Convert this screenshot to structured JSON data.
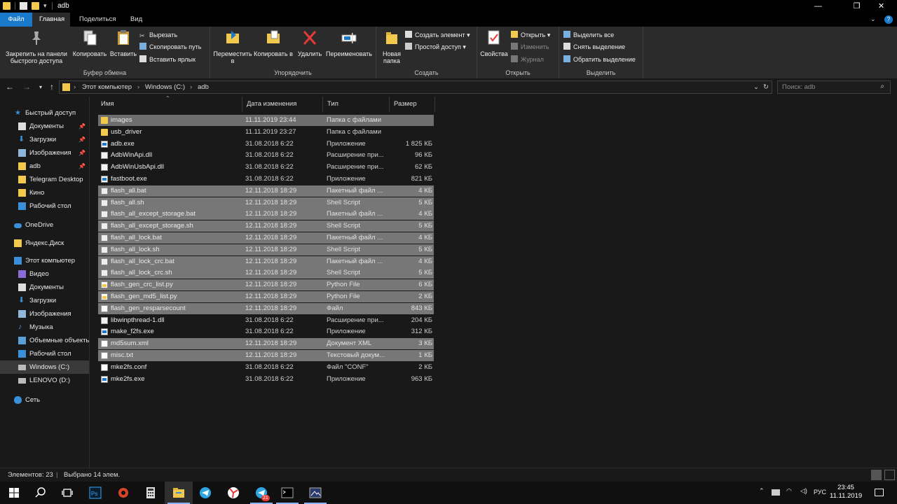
{
  "window": {
    "title": "adb",
    "controls": {
      "minimize": "—",
      "maximize": "❐",
      "close": "✕"
    }
  },
  "ribbon_tabs": [
    "Файл",
    "Главная",
    "Поделиться",
    "Вид"
  ],
  "ribbon": {
    "clipboard": {
      "pin_label": "Закрепить на панели быстрого доступа",
      "copy": "Копировать",
      "paste": "Вставить",
      "cut": "Вырезать",
      "copy_path": "Скопировать путь",
      "paste_shortcut": "Вставить ярлык",
      "group": "Буфер обмена"
    },
    "organize": {
      "move": "Переместить в",
      "copy_to": "Копировать в",
      "delete": "Удалить",
      "rename": "Переименовать",
      "group": "Упорядочить"
    },
    "new": {
      "new_folder": "Новая папка",
      "new_item": "Создать элемент",
      "easy_access": "Простой доступ",
      "group": "Создать"
    },
    "open": {
      "properties": "Свойства",
      "open": "Открыть",
      "edit": "Изменить",
      "history": "Журнал",
      "group": "Открыть"
    },
    "select": {
      "select_all": "Выделить все",
      "select_none": "Снять выделение",
      "invert": "Обратить выделение",
      "group": "Выделить"
    }
  },
  "address": {
    "crumbs": [
      "Этот компьютер",
      "Windows (C:)",
      "adb"
    ],
    "search_placeholder": "Поиск: adb"
  },
  "nav": {
    "quick_access": "Быстрый доступ",
    "items": [
      "Документы",
      "Загрузки",
      "Изображения",
      "adb",
      "Telegram Desktop",
      "Кино",
      "Рабочий стол"
    ],
    "onedrive": "OneDrive",
    "yandex": "Яндекс.Диск",
    "this_pc": "Этот компьютер",
    "pc_items": [
      "Видео",
      "Документы",
      "Загрузки",
      "Изображения",
      "Музыка",
      "Объемные объекты",
      "Рабочий стол",
      "Windows (C:)",
      "LENOVO (D:)"
    ],
    "network": "Сеть"
  },
  "columns": {
    "name": "Имя",
    "date": "Дата изменения",
    "type": "Тип",
    "size": "Размер"
  },
  "files": [
    {
      "name": "images",
      "date": "11.11.2019 23:44",
      "type": "Папка с файлами",
      "size": "",
      "icon": "folder",
      "selected": true
    },
    {
      "name": "usb_driver",
      "date": "11.11.2019 23:27",
      "type": "Папка с файлами",
      "size": "",
      "icon": "folder",
      "selected": false
    },
    {
      "name": "adb.exe",
      "date": "31.08.2018 6:22",
      "type": "Приложение",
      "size": "1 825 КБ",
      "icon": "exe",
      "selected": false
    },
    {
      "name": "AdbWinApi.dll",
      "date": "31.08.2018 6:22",
      "type": "Расширение при...",
      "size": "96 КБ",
      "icon": "dll",
      "selected": false
    },
    {
      "name": "AdbWinUsbApi.dll",
      "date": "31.08.2018 6:22",
      "type": "Расширение при...",
      "size": "62 КБ",
      "icon": "dll",
      "selected": false
    },
    {
      "name": "fastboot.exe",
      "date": "31.08.2018 6:22",
      "type": "Приложение",
      "size": "821 КБ",
      "icon": "exe",
      "selected": false
    },
    {
      "name": "flash_all.bat",
      "date": "12.11.2018 18:29",
      "type": "Пакетный файл ...",
      "size": "4 КБ",
      "icon": "script",
      "selected": true
    },
    {
      "name": "flash_all.sh",
      "date": "12.11.2018 18:29",
      "type": "Shell Script",
      "size": "5 КБ",
      "icon": "script",
      "selected": true
    },
    {
      "name": "flash_all_except_storage.bat",
      "date": "12.11.2018 18:29",
      "type": "Пакетный файл ...",
      "size": "4 КБ",
      "icon": "script",
      "selected": true
    },
    {
      "name": "flash_all_except_storage.sh",
      "date": "12.11.2018 18:29",
      "type": "Shell Script",
      "size": "5 КБ",
      "icon": "script",
      "selected": true
    },
    {
      "name": "flash_all_lock.bat",
      "date": "12.11.2018 18:29",
      "type": "Пакетный файл ...",
      "size": "4 КБ",
      "icon": "script",
      "selected": true
    },
    {
      "name": "flash_all_lock.sh",
      "date": "12.11.2018 18:29",
      "type": "Shell Script",
      "size": "5 КБ",
      "icon": "script",
      "selected": true
    },
    {
      "name": "flash_all_lock_crc.bat",
      "date": "12.11.2018 18:29",
      "type": "Пакетный файл ...",
      "size": "4 КБ",
      "icon": "script",
      "selected": true
    },
    {
      "name": "flash_all_lock_crc.sh",
      "date": "12.11.2018 18:29",
      "type": "Shell Script",
      "size": "5 КБ",
      "icon": "script",
      "selected": true
    },
    {
      "name": "flash_gen_crc_list.py",
      "date": "12.11.2018 18:29",
      "type": "Python File",
      "size": "6 КБ",
      "icon": "py",
      "selected": true
    },
    {
      "name": "flash_gen_md5_list.py",
      "date": "12.11.2018 18:29",
      "type": "Python File",
      "size": "2 КБ",
      "icon": "py",
      "selected": true
    },
    {
      "name": "flash_gen_resparsecount",
      "date": "12.11.2018 18:29",
      "type": "Файл",
      "size": "843 КБ",
      "icon": "file",
      "selected": true
    },
    {
      "name": "libwinpthread-1.dll",
      "date": "31.08.2018 6:22",
      "type": "Расширение при...",
      "size": "204 КБ",
      "icon": "dll",
      "selected": false
    },
    {
      "name": "make_f2fs.exe",
      "date": "31.08.2018 6:22",
      "type": "Приложение",
      "size": "312 КБ",
      "icon": "exe",
      "selected": false
    },
    {
      "name": "md5sum.xml",
      "date": "12.11.2018 18:29",
      "type": "Документ XML",
      "size": "3 КБ",
      "icon": "file",
      "selected": true
    },
    {
      "name": "misc.txt",
      "date": "12.11.2018 18:29",
      "type": "Текстовый докум...",
      "size": "1 КБ",
      "icon": "file",
      "selected": true
    },
    {
      "name": "mke2fs.conf",
      "date": "31.08.2018 6:22",
      "type": "Файл \"CONF\"",
      "size": "2 КБ",
      "icon": "file",
      "selected": false
    },
    {
      "name": "mke2fs.exe",
      "date": "31.08.2018 6:22",
      "type": "Приложение",
      "size": "963 КБ",
      "icon": "exe",
      "selected": false
    }
  ],
  "status": {
    "items": "Элементов: 23",
    "separator": "|",
    "selected": "Выбрано 14 элем."
  },
  "taskbar": {
    "lang": "РУС",
    "time": "23:45",
    "date": "11.11.2019",
    "chat_badge": "21"
  },
  "colors": {
    "file_tab": "#1979ca",
    "selection": "#777777",
    "folder": "#f2c94c"
  }
}
